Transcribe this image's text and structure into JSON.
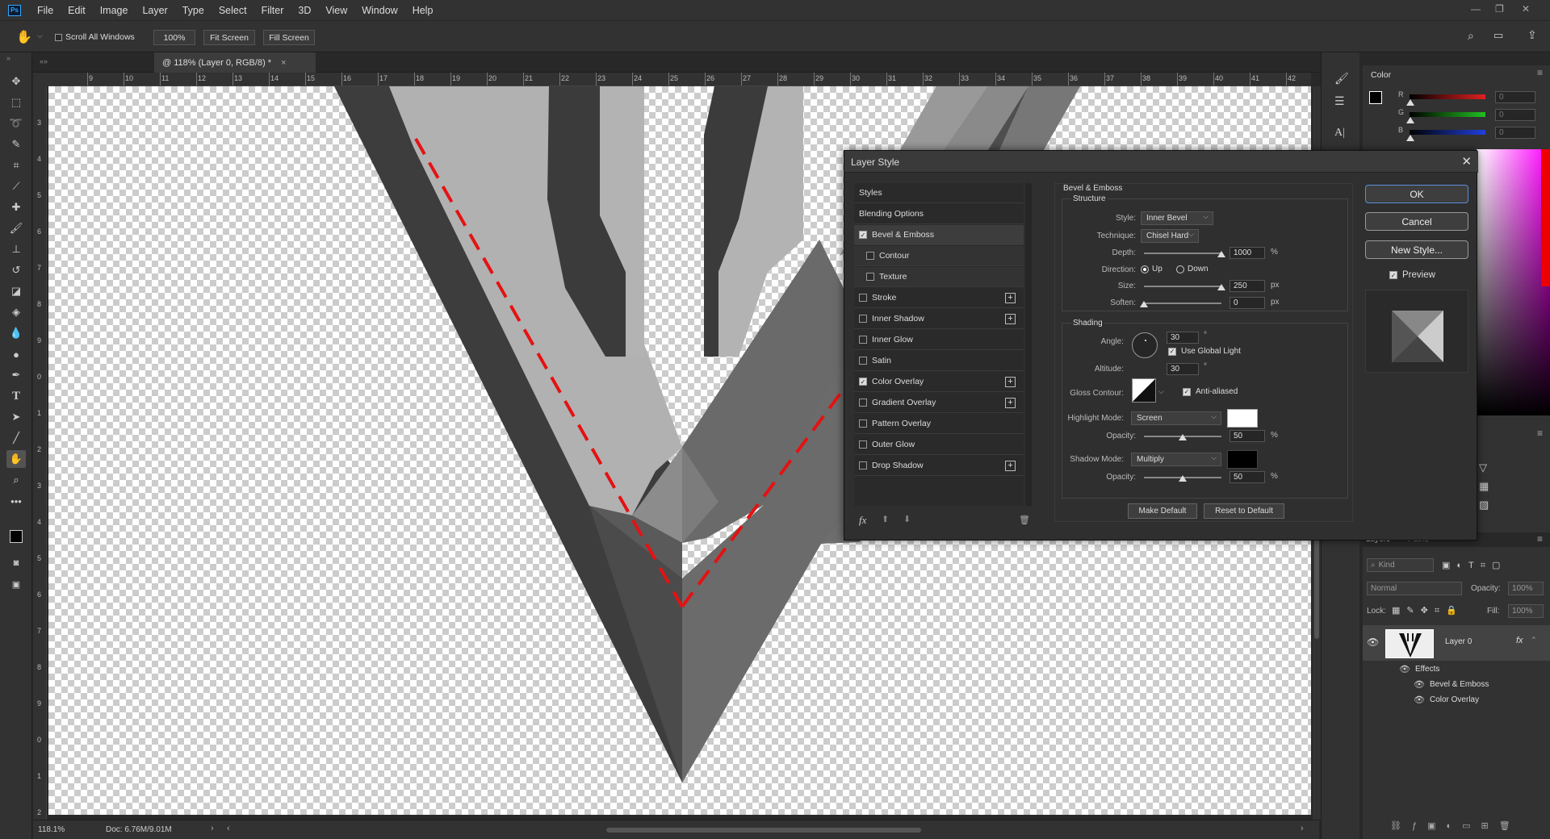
{
  "app": {
    "logo": "Ps",
    "menu": [
      "File",
      "Edit",
      "Image",
      "Layer",
      "Type",
      "Select",
      "Filter",
      "3D",
      "View",
      "Window",
      "Help"
    ]
  },
  "options": {
    "scroll_all_windows": "Scroll All Windows",
    "zoom": "100%",
    "fit_screen": "Fit Screen",
    "fill_screen": "Fill Screen"
  },
  "document": {
    "tab_title": "@ 118% (Layer 0, RGB/8) *",
    "ruler_h": [
      "9",
      "10",
      "11",
      "12",
      "13",
      "14",
      "15",
      "16",
      "17",
      "18",
      "19",
      "20",
      "21",
      "22",
      "23",
      "24",
      "25",
      "26",
      "27",
      "28",
      "29",
      "30",
      "31",
      "32",
      "33",
      "34",
      "35",
      "36",
      "37",
      "38",
      "39",
      "40",
      "41",
      "42"
    ],
    "ruler_v": [
      "3",
      "4",
      "5",
      "6",
      "7",
      "8",
      "9",
      "0",
      "1",
      "2",
      "3",
      "4",
      "5",
      "6",
      "7",
      "8",
      "9",
      "0",
      "1",
      "2"
    ]
  },
  "status": {
    "zoom": "118.1%",
    "doc": "Doc: 6.76M/9.01M"
  },
  "color_panel": {
    "title": "Color",
    "channels": [
      {
        "name": "R",
        "value": "0",
        "color": "#e02020"
      },
      {
        "name": "G",
        "value": "0",
        "color": "#20c020"
      },
      {
        "name": "B",
        "value": "0",
        "color": "#2040e0"
      }
    ]
  },
  "layers_panel": {
    "tab_layers": "Layers",
    "tab_paths": "Paths",
    "kind": "Kind",
    "blend": "Normal",
    "opacity_label": "Opacity:",
    "opacity": "100%",
    "lock_label": "Lock:",
    "fill_label": "Fill:",
    "fill": "100%",
    "layer_name": "Layer 0",
    "effects_label": "Effects",
    "effects": [
      "Bevel & Emboss",
      "Color Overlay"
    ]
  },
  "dialog": {
    "title": "Layer Style",
    "styles_header": "Styles",
    "styles": [
      {
        "label": "Blending Options",
        "checkbox": false,
        "checked": false,
        "plus": false,
        "indent": false,
        "selected": false
      },
      {
        "label": "Bevel & Emboss",
        "checkbox": true,
        "checked": true,
        "plus": false,
        "indent": false,
        "selected": true
      },
      {
        "label": "Contour",
        "checkbox": true,
        "checked": false,
        "plus": false,
        "indent": true,
        "selected": false
      },
      {
        "label": "Texture",
        "checkbox": true,
        "checked": false,
        "plus": false,
        "indent": true,
        "selected": false
      },
      {
        "label": "Stroke",
        "checkbox": true,
        "checked": false,
        "plus": true,
        "indent": false,
        "selected": false
      },
      {
        "label": "Inner Shadow",
        "checkbox": true,
        "checked": false,
        "plus": true,
        "indent": false,
        "selected": false
      },
      {
        "label": "Inner Glow",
        "checkbox": true,
        "checked": false,
        "plus": false,
        "indent": false,
        "selected": false
      },
      {
        "label": "Satin",
        "checkbox": true,
        "checked": false,
        "plus": false,
        "indent": false,
        "selected": false
      },
      {
        "label": "Color Overlay",
        "checkbox": true,
        "checked": true,
        "plus": true,
        "indent": false,
        "selected": false
      },
      {
        "label": "Gradient Overlay",
        "checkbox": true,
        "checked": false,
        "plus": true,
        "indent": false,
        "selected": false
      },
      {
        "label": "Pattern Overlay",
        "checkbox": true,
        "checked": false,
        "plus": false,
        "indent": false,
        "selected": false
      },
      {
        "label": "Outer Glow",
        "checkbox": true,
        "checked": false,
        "plus": false,
        "indent": false,
        "selected": false
      },
      {
        "label": "Drop Shadow",
        "checkbox": true,
        "checked": false,
        "plus": true,
        "indent": false,
        "selected": false
      }
    ],
    "bevel": {
      "section": "Bevel & Emboss",
      "structure": "Structure",
      "style_label": "Style:",
      "style": "Inner Bevel",
      "technique_label": "Technique:",
      "technique": "Chisel Hard",
      "depth_label": "Depth:",
      "depth": "1000",
      "depth_pos": 1.0,
      "pct": "%",
      "direction_label": "Direction:",
      "up": "Up",
      "down": "Down",
      "size_label": "Size:",
      "size": "250",
      "size_pos": 1.0,
      "px": "px",
      "soften_label": "Soften:",
      "soften": "0",
      "soften_pos": 0.0
    },
    "shading": {
      "section": "Shading",
      "angle_label": "Angle:",
      "angle": "30",
      "deg": "°",
      "use_global": "Use Global Light",
      "altitude_label": "Altitude:",
      "altitude": "30",
      "gloss_label": "Gloss Contour:",
      "anti_aliased": "Anti-aliased",
      "highlight_label": "Highlight Mode:",
      "highlight_mode": "Screen",
      "highlight_color": "#ffffff",
      "opacity_label": "Opacity:",
      "highlight_opacity": "50",
      "highlight_pos": 0.5,
      "shadow_label": "Shadow Mode:",
      "shadow_mode": "Multiply",
      "shadow_color": "#000000",
      "shadow_opacity": "50",
      "shadow_pos": 0.5
    },
    "make_default": "Make Default",
    "reset_default": "Reset to Default",
    "ok": "OK",
    "cancel": "Cancel",
    "new_style": "New Style...",
    "preview": "Preview"
  }
}
